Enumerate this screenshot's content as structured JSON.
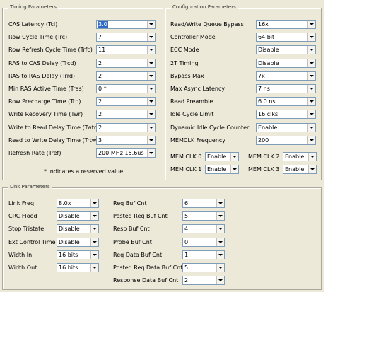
{
  "timing": {
    "title": "Timing Parameters",
    "rows": [
      {
        "label": "CAS Latency (Tcl)",
        "value": "3.0",
        "selected": true
      },
      {
        "label": "Row Cycle Time (Trc)",
        "value": "7"
      },
      {
        "label": "Row Refresh Cycle Time (Trfc)",
        "value": "11"
      },
      {
        "label": "RAS to CAS Delay (Trcd)",
        "value": "2"
      },
      {
        "label": "RAS to RAS Delay (Trrd)",
        "value": "2"
      },
      {
        "label": "Min RAS Active Time (Tras)",
        "value": "0 *"
      },
      {
        "label": "Row Precharge Time (Trp)",
        "value": "2"
      },
      {
        "label": "Write Recovery Time (Twr)",
        "value": "2"
      },
      {
        "label": "Write to Read Delay Time (Twtr)",
        "value": "2"
      },
      {
        "label": "Read to Write Delay Time (Trtw)",
        "value": "3"
      },
      {
        "label": "Refresh Rate (Tref)",
        "value": "200 MHz 15.6us"
      }
    ],
    "note": "* indicates a reserved value"
  },
  "config": {
    "title": "Configuration Parameters",
    "rows": [
      {
        "label": "Read/Write Queue Bypass",
        "value": "16x"
      },
      {
        "label": "Controller Mode",
        "value": "64 bit"
      },
      {
        "label": "ECC Mode",
        "value": "Disable"
      },
      {
        "label": "2T Timing",
        "value": "Disable"
      },
      {
        "label": "Bypass Max",
        "value": "7x"
      },
      {
        "label": "Max Async Latency",
        "value": "7 ns"
      },
      {
        "label": "Read Preamble",
        "value": "6.0 ns"
      },
      {
        "label": "Idle Cycle Limit",
        "value": "16 clks"
      },
      {
        "label": "Dynamic Idle Cycle Counter",
        "value": "Enable"
      },
      {
        "label": "MEMCLK Frequency",
        "value": "200"
      }
    ],
    "memclk": [
      {
        "label": "MEM CLK 0",
        "value": "Enable"
      },
      {
        "label": "MEM CLK 2",
        "value": "Enable"
      },
      {
        "label": "MEM CLK 1",
        "value": "Enable"
      },
      {
        "label": "MEM CLK 3",
        "value": "Enable"
      }
    ]
  },
  "link": {
    "title": "Link Parameters",
    "left": [
      {
        "label": "Link Freq",
        "value": "8.0x"
      },
      {
        "label": "CRC Flood",
        "value": "Disable"
      },
      {
        "label": "Stop Tristate",
        "value": "Disable"
      },
      {
        "label": "Ext Control Time",
        "value": "Disable"
      },
      {
        "label": "Width In",
        "value": "16 bits"
      },
      {
        "label": "Width Out",
        "value": "16 bits"
      }
    ],
    "right": [
      {
        "label": "Req Buf Cnt",
        "value": "6"
      },
      {
        "label": "Posted Req Buf Cnt",
        "value": "5"
      },
      {
        "label": "Resp Buf Cnt",
        "value": "4"
      },
      {
        "label": "Probe Buf Cnt",
        "value": "0"
      },
      {
        "label": "Req Data Buf Cnt",
        "value": "1"
      },
      {
        "label": "Posted Req Data Buf Cnt",
        "value": "5"
      },
      {
        "label": "Response Data Buf Cnt",
        "value": "2"
      }
    ]
  }
}
